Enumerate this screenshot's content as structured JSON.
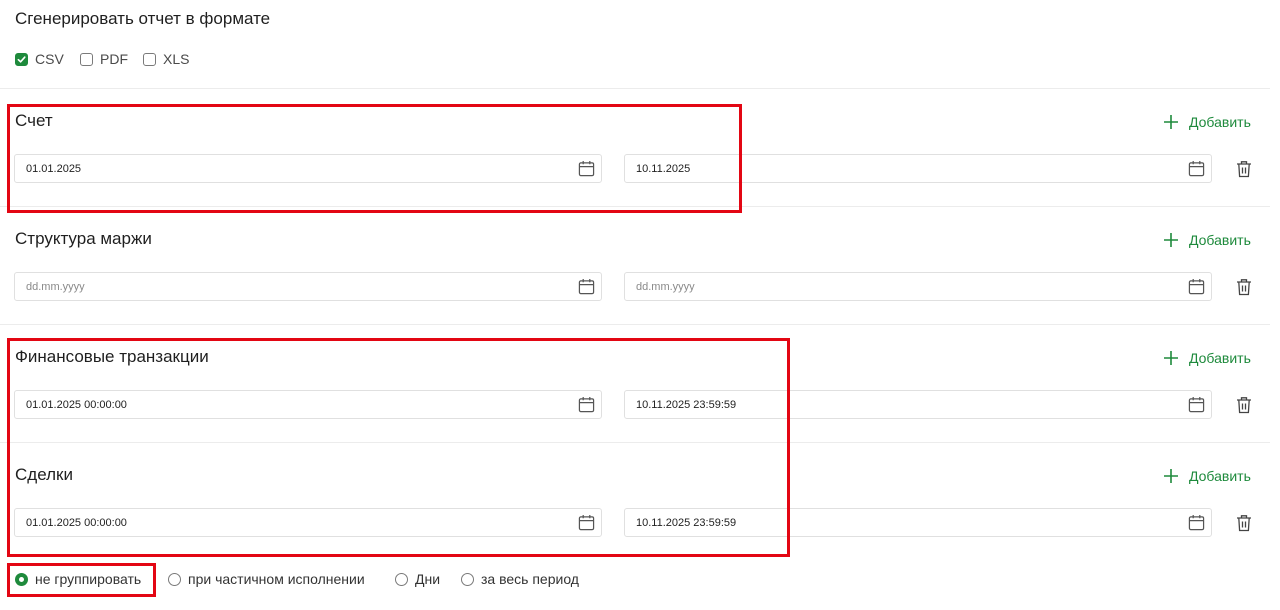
{
  "report_format": {
    "title": "Сгенерировать отчет в формате",
    "options": [
      {
        "label": "CSV",
        "checked": true
      },
      {
        "label": "PDF",
        "checked": false
      },
      {
        "label": "XLS",
        "checked": false
      }
    ]
  },
  "add_label": "Добавить",
  "sections": [
    {
      "title": "Счет",
      "from": {
        "value": "01.01.2025",
        "placeholder": "dd.mm.yyyy"
      },
      "to": {
        "value": "10.11.2025",
        "placeholder": "dd.mm.yyyy"
      }
    },
    {
      "title": "Структура маржи",
      "from": {
        "value": "",
        "placeholder": "dd.mm.yyyy"
      },
      "to": {
        "value": "",
        "placeholder": "dd.mm.yyyy"
      }
    },
    {
      "title": "Финансовые транзакции",
      "from": {
        "value": "01.01.2025 00:00:00",
        "placeholder": "dd.mm.yyyy"
      },
      "to": {
        "value": "10.11.2025 23:59:59",
        "placeholder": "dd.mm.yyyy"
      }
    },
    {
      "title": "Сделки",
      "from": {
        "value": "01.01.2025 00:00:00",
        "placeholder": "dd.mm.yyyy"
      },
      "to": {
        "value": "10.11.2025 23:59:59",
        "placeholder": "dd.mm.yyyy"
      }
    }
  ],
  "grouping": {
    "options": [
      {
        "label": "не группировать",
        "selected": true
      },
      {
        "label": "при частичном исполнении",
        "selected": false
      },
      {
        "label": "Дни",
        "selected": false
      },
      {
        "label": "за весь период",
        "selected": false
      }
    ]
  },
  "colors": {
    "accent": "#1e8a3c",
    "highlight": "#e30613"
  },
  "icons": {
    "add": "plus-icon",
    "date": "calendar-icon",
    "delete": "trash-icon",
    "checked": "check-icon"
  }
}
